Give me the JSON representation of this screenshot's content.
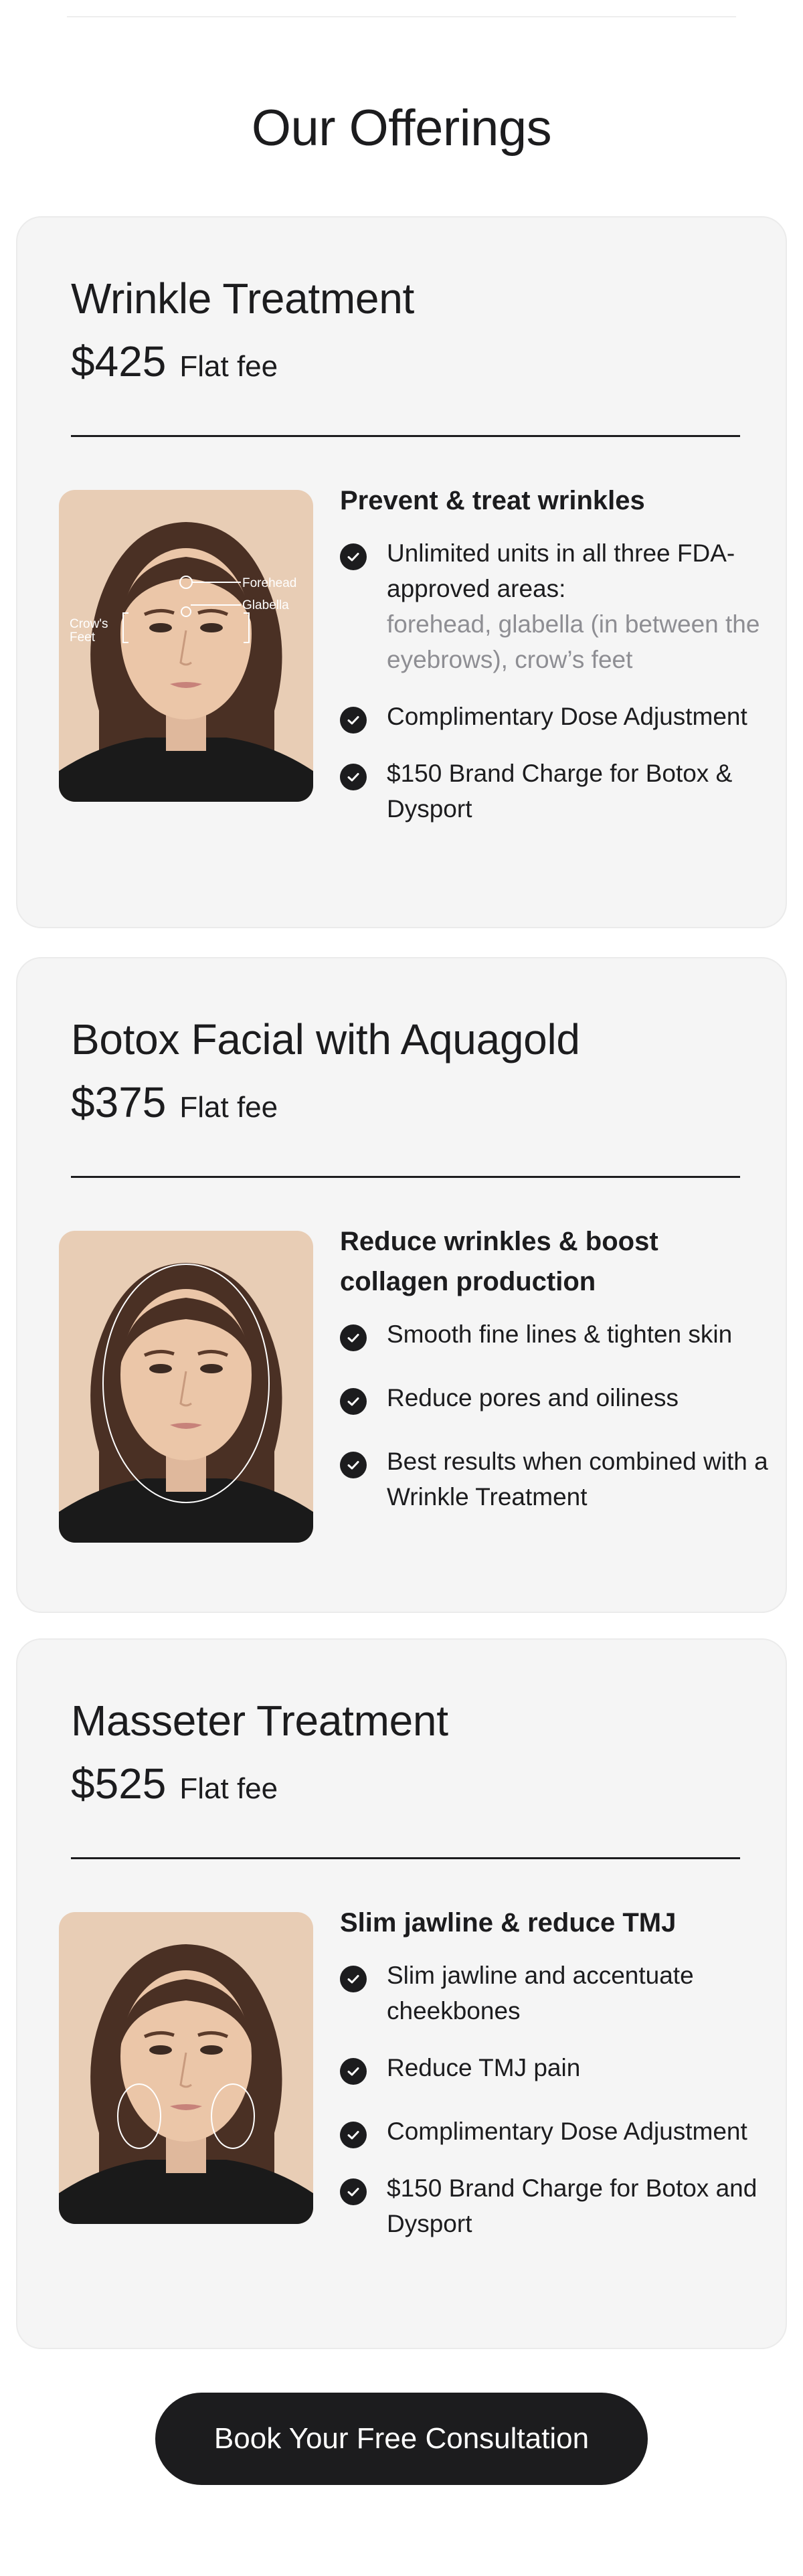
{
  "page": {
    "title": "Our Offerings"
  },
  "offerings": [
    {
      "title": "Wrinkle Treatment",
      "price": "$425",
      "fee_label": "Flat fee",
      "heading": "Prevent & treat wrinkles",
      "photo_labels": {
        "forehead": "Forehead",
        "glabella": "Glabella",
        "crows_feet_line1": "Crow's",
        "crows_feet_line2": "Feet"
      },
      "bullets": [
        {
          "text": "Unlimited units in all three FDA-approved areas:",
          "note": "forehead, glabella (in between the eyebrows), crow’s feet"
        },
        {
          "text": "Complimentary Dose Adjustment"
        },
        {
          "text": "$150 Brand Charge for Botox & Dysport"
        }
      ]
    },
    {
      "title": "Botox Facial with Aquagold",
      "price": "$375",
      "fee_label": "Flat fee",
      "heading": "Reduce wrinkles & boost collagen production",
      "bullets": [
        {
          "text": "Smooth fine lines & tighten skin"
        },
        {
          "text": "Reduce pores and oiliness"
        },
        {
          "text": "Best results when combined with a Wrinkle Treatment"
        }
      ]
    },
    {
      "title": "Masseter Treatment",
      "price": "$525",
      "fee_label": "Flat fee",
      "heading": "Slim jawline & reduce TMJ",
      "bullets": [
        {
          "text": "Slim jawline and accentuate cheekbones"
        },
        {
          "text": "Reduce TMJ pain"
        },
        {
          "text": "Complimentary Dose Adjustment"
        },
        {
          "text": "$150 Brand Charge for Botox and Dysport"
        }
      ]
    }
  ],
  "cta": {
    "label": "Book Your Free Consultation"
  },
  "colors": {
    "text": "#1c1c1e",
    "card_bg": "#f5f5f5",
    "muted": "#8e8e93",
    "photo_bg": "#e8cdb5"
  }
}
